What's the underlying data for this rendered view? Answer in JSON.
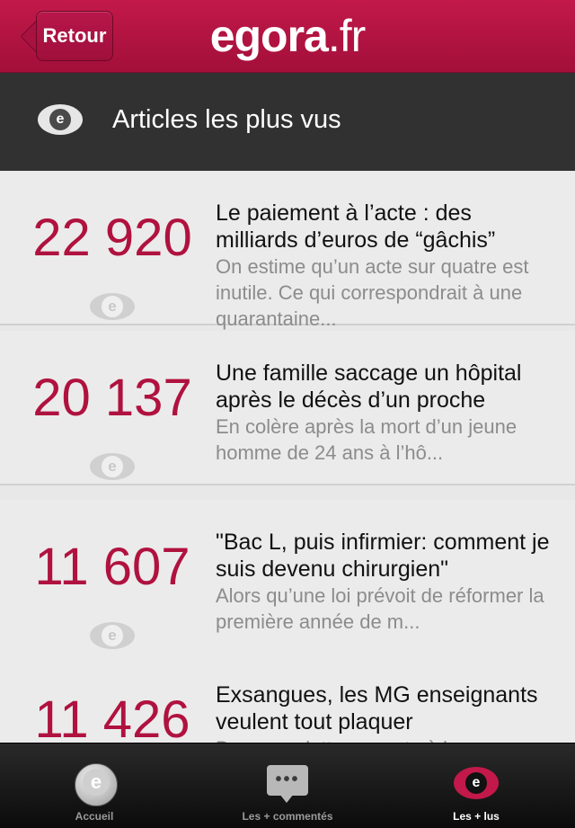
{
  "navbar": {
    "back_label": "Retour",
    "logo_main": "egora",
    "logo_tld": ".fr"
  },
  "header": {
    "icon": "eye-icon",
    "title": "Articles les plus vus"
  },
  "articles": [
    {
      "count": "22 920",
      "title": "Le paiement à l’acte : des milliards d’euros de “gâchis”",
      "excerpt": "On estime qu’un acte sur quatre est inutile. Ce qui correspondrait à une quarantaine..."
    },
    {
      "count": "20 137",
      "title": "Une famille saccage un hôpital après le décès d’un proche",
      "excerpt": "En colère après la mort d’un jeune homme de 24 ans à l’hô..."
    },
    {
      "count": "11 607",
      "title": "\"Bac L, puis infirmier: comment je suis devenu chirurgien\"",
      "excerpt": "Alors qu’une loi prévoit de réformer la première année de m..."
    },
    {
      "count": "11 426",
      "title": "Exsangues, les MG enseignants veulent tout plaquer",
      "excerpt": "Dans une lettre ouverte à la"
    }
  ],
  "eye_letter": "e",
  "tabbar": {
    "tabs": [
      {
        "label": "Accueil",
        "icon": "home-e-icon",
        "active": false
      },
      {
        "label": "Les + commentés",
        "icon": "comment-bubble-icon",
        "active": false
      },
      {
        "label": "Les + lus",
        "icon": "eye-icon",
        "active": true
      }
    ],
    "comment_dots": "•••"
  },
  "colors": {
    "brand": "#b0123f",
    "header_bg": "#313131",
    "list_bg": "#ebebeb"
  }
}
